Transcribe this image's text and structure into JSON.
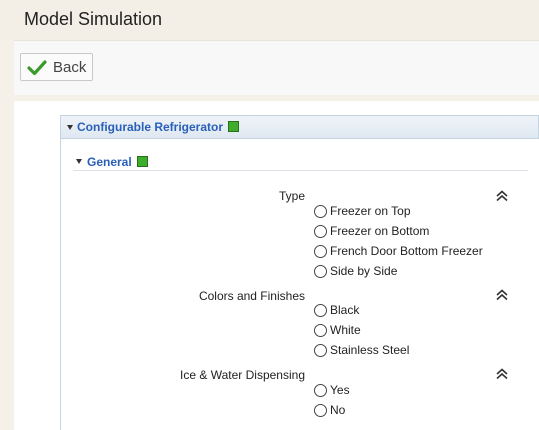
{
  "app": {
    "title": "Model Simulation"
  },
  "toolbar": {
    "back_label": "Back"
  },
  "panel": {
    "title": "Configurable Refrigerator",
    "section": {
      "title": "General",
      "fields": [
        {
          "label": "Type",
          "options": [
            "Freezer on Top",
            "Freezer on Bottom",
            "French Door Bottom Freezer",
            "Side by Side"
          ]
        },
        {
          "label": "Colors and Finishes",
          "options": [
            "Black",
            "White",
            "Stainless Steel"
          ]
        },
        {
          "label": "Ice & Water Dispensing",
          "options": [
            "Yes",
            "No"
          ]
        }
      ]
    }
  },
  "colors": {
    "status_ok": "#3dae2b",
    "link_blue": "#2a60b8",
    "check_green": "#3a9a2a"
  },
  "icons": [
    "check-icon",
    "caret-down-icon",
    "status-icon",
    "collapse-icon"
  ]
}
